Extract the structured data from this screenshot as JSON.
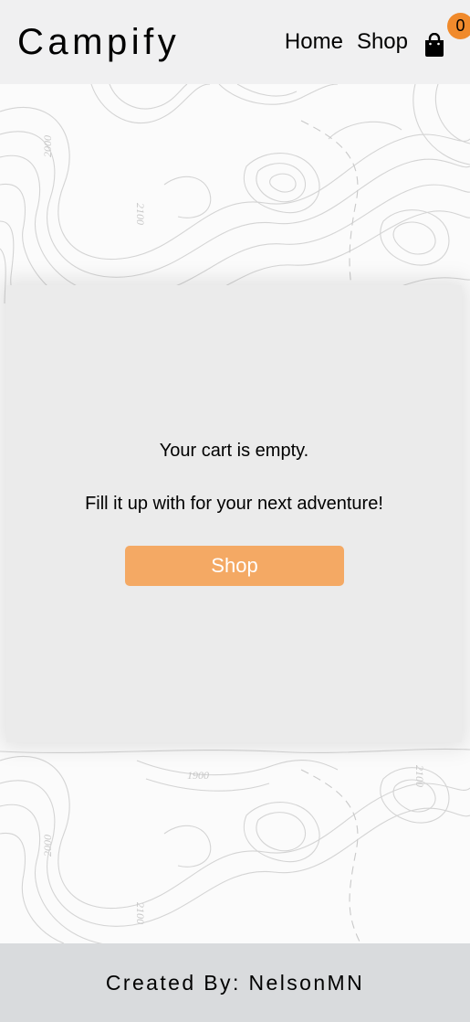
{
  "header": {
    "brand": "Campify",
    "nav": [
      {
        "label": "Home"
      },
      {
        "label": "Shop"
      }
    ],
    "cart": {
      "icon": "shopping-bag-icon",
      "count": "0",
      "badge_color": "#f08a2c"
    }
  },
  "background": {
    "contour_labels": [
      "2000",
      "2100",
      "1900",
      "2100",
      "2000",
      "2100"
    ]
  },
  "cart_page": {
    "empty_message": "Your cart is empty.",
    "prompt": "Fill it up with for your next adventure!",
    "shop_button": "Shop",
    "button_color": "#f4a964"
  },
  "footer": {
    "text": "Created By: NelsonMN"
  }
}
